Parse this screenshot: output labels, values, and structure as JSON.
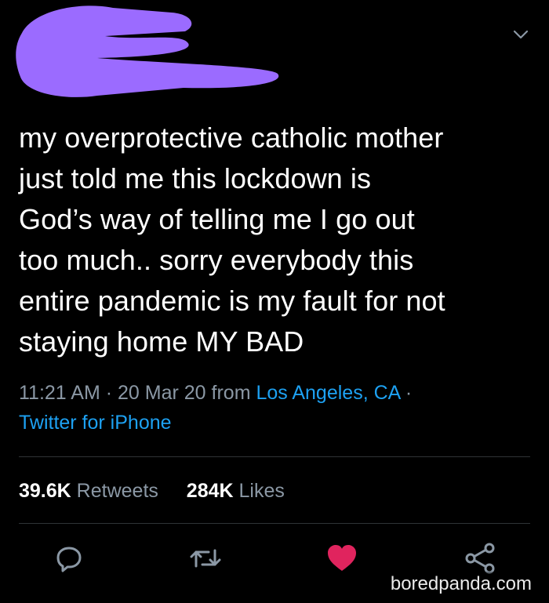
{
  "tweet": {
    "text": "my overprotective catholic mother\njust told me this lockdown is\nGod’s way of telling me I go out\ntoo much.. sorry everybody this\nentire pandemic is my fault for not\nstaying home MY BAD",
    "time": "11:21 AM",
    "date": "20 Mar 20",
    "from_prefix": "from",
    "location": "Los Angeles, CA",
    "source": "Twitter for iPhone",
    "sep": "·"
  },
  "stats": {
    "retweets_count": "39.6K",
    "retweets_label": "Retweets",
    "likes_count": "284K",
    "likes_label": "Likes"
  },
  "colors": {
    "background": "#000000",
    "text": "#ffffff",
    "muted": "#8b98a5",
    "link": "#1da1f2",
    "like": "#e0245e",
    "redaction": "#9b6bff"
  },
  "icons": {
    "menu": "chevron-down-icon",
    "reply": "reply-icon",
    "retweet": "retweet-icon",
    "like": "heart-icon",
    "share": "share-icon"
  },
  "watermark": "boredpanda.com"
}
